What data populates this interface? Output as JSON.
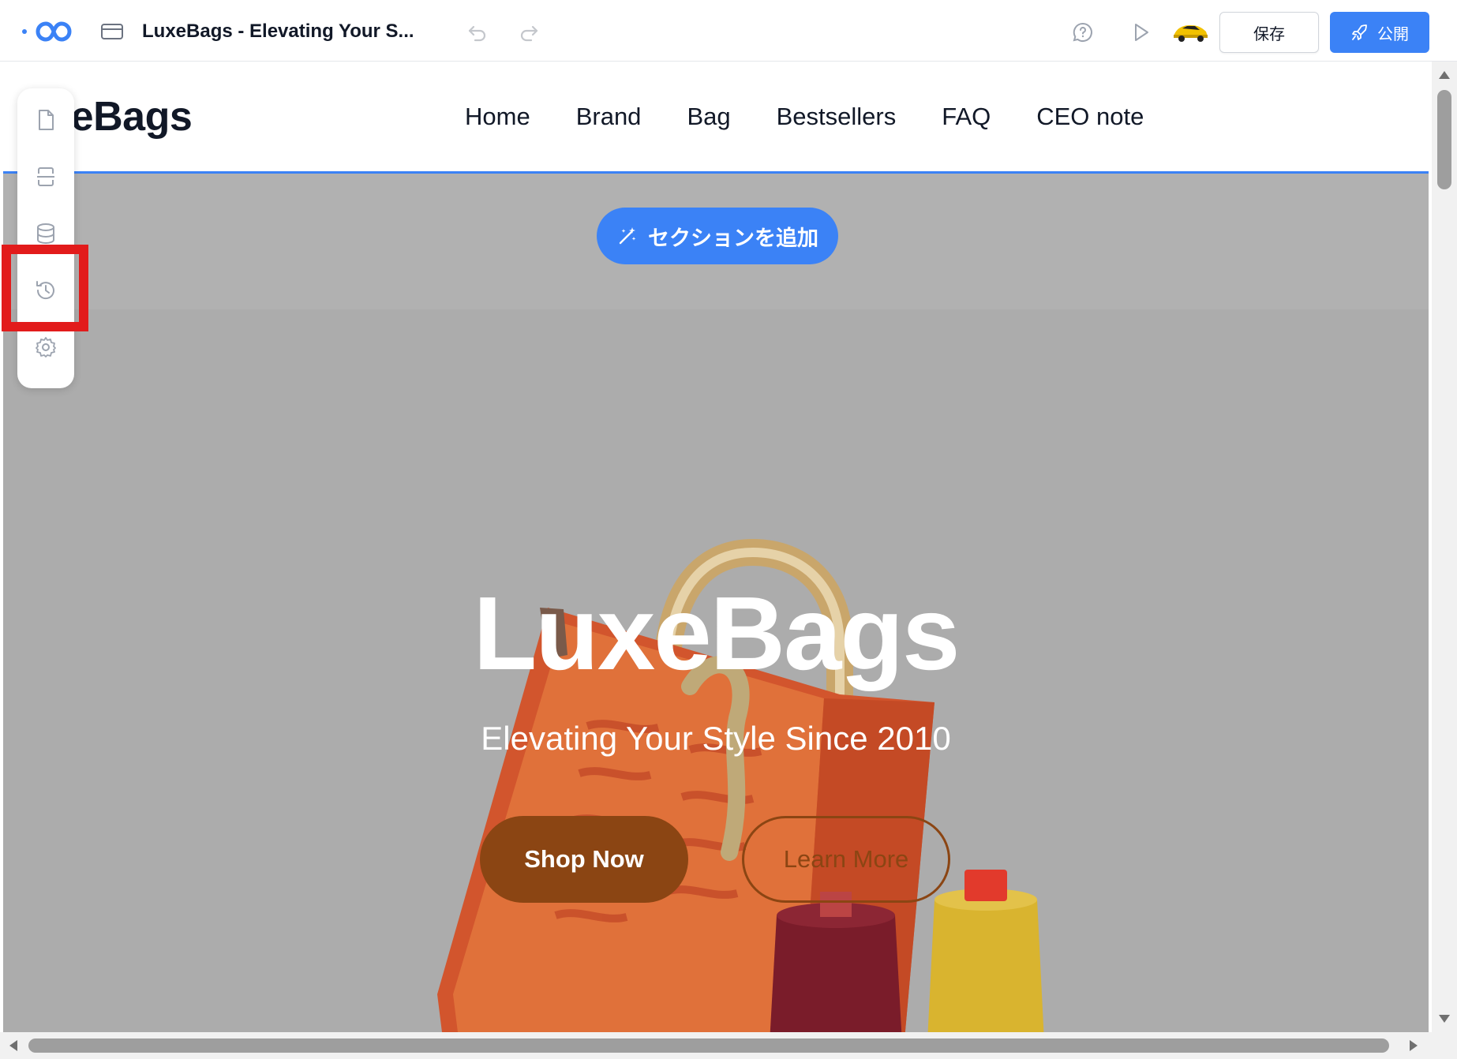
{
  "editor": {
    "title": "LuxeBags - Elevating Your S...",
    "save_label": "保存",
    "publish_label": "公開",
    "icons": {
      "logo": "infinity-logo-icon",
      "page": "browser-window-icon",
      "undo": "undo-icon",
      "redo": "redo-icon",
      "help": "help-chat-icon",
      "preview": "play-icon",
      "avatar": "car-avatar"
    },
    "colors": {
      "accent": "#3b82f6",
      "highlight": "#e21b1b"
    }
  },
  "rail": {
    "items": [
      {
        "name": "pages",
        "icon": "file-icon"
      },
      {
        "name": "sections",
        "icon": "section-layout-icon"
      },
      {
        "name": "database",
        "icon": "database-icon"
      },
      {
        "name": "history",
        "icon": "history-icon",
        "highlighted": true
      },
      {
        "name": "settings",
        "icon": "gear-icon"
      }
    ]
  },
  "site": {
    "brand": "uxeBags",
    "nav": [
      "Home",
      "Brand",
      "Bag",
      "Bestsellers",
      "FAQ",
      "CEO note"
    ],
    "add_section_label": "セクションを追加",
    "hero": {
      "title": "LuxeBags",
      "subtitle": "Elevating Your Style Since 2010",
      "primary_cta": "Shop Now",
      "secondary_cta": "Learn More",
      "colors": {
        "cta": "#8b4513",
        "background": "#acacac"
      }
    }
  }
}
